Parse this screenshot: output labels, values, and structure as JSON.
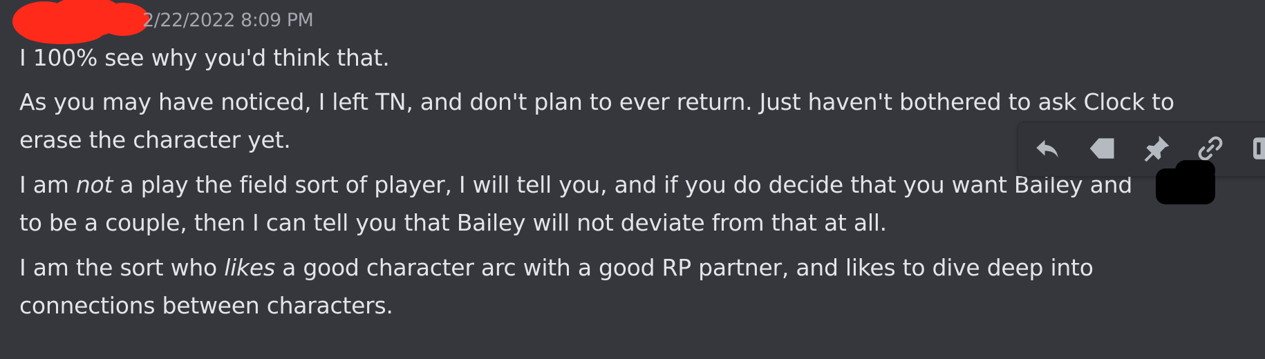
{
  "message": {
    "timestamp": "12/22/2022 8:09 PM",
    "timestamp_visible": "2/22/2022 8:09 PM",
    "paragraphs": [
      {
        "text": "I 100% see why you'd think that."
      },
      {
        "line1": "As you may have noticed, I left TN, and don't plan to ever return. Just haven't bothered to ask Clock to",
        "line2": "erase the character yet."
      },
      {
        "pre": "I am ",
        "em": "not",
        "post": " a play the field sort of player, I will tell you, and if you do decide that you want Bailey and",
        "line2": "to be a couple, then I can tell you that Bailey will not deviate from that at all."
      },
      {
        "pre": "I am the sort who ",
        "em": "likes",
        "post": " a good character arc with a good RP partner, and likes to dive deep into",
        "line2": "connections between characters."
      }
    ]
  },
  "toolbar": {
    "buttons": [
      {
        "name": "reply-icon"
      },
      {
        "name": "tag-icon"
      },
      {
        "name": "pin-icon"
      },
      {
        "name": "link-icon"
      },
      {
        "name": "more-icon"
      }
    ]
  },
  "colors": {
    "background": "#36373d",
    "text": "#e3e5e8",
    "timestamp": "#a3a6ad",
    "toolbar": "#313338"
  }
}
